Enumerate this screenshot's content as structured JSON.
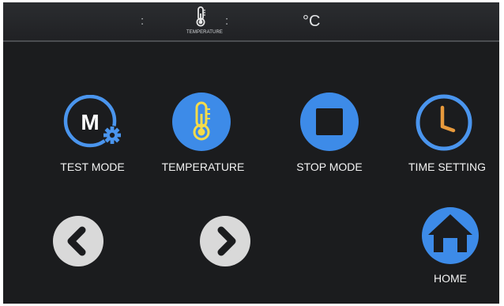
{
  "status_bar": {
    "separator_left": ":",
    "separator_right": ":",
    "icon": "thermometer-icon",
    "caption": "TEMPERATURE",
    "unit": "°C"
  },
  "buttons": [
    {
      "label": "TEST MODE",
      "icon": "test-mode-gear-icon"
    },
    {
      "label": "TEMPERATURE",
      "icon": "thermometer-icon"
    },
    {
      "label": "STOP MODE",
      "icon": "stop-square-icon"
    },
    {
      "label": "TIME SETTING",
      "icon": "clock-icon"
    }
  ],
  "navigation": {
    "previous_icon": "chevron-left-icon",
    "next_icon": "chevron-right-icon",
    "home_label": "HOME",
    "home_icon": "home-icon"
  },
  "colors": {
    "background": "#1b1c1e",
    "accent_blue": "#3d8be8",
    "outline_blue": "#4a95ee",
    "thermometer_yellow": "#f5dc4a",
    "clock_hand_orange": "#e89a3c",
    "nav_button_gray": "#d9d9d9"
  }
}
